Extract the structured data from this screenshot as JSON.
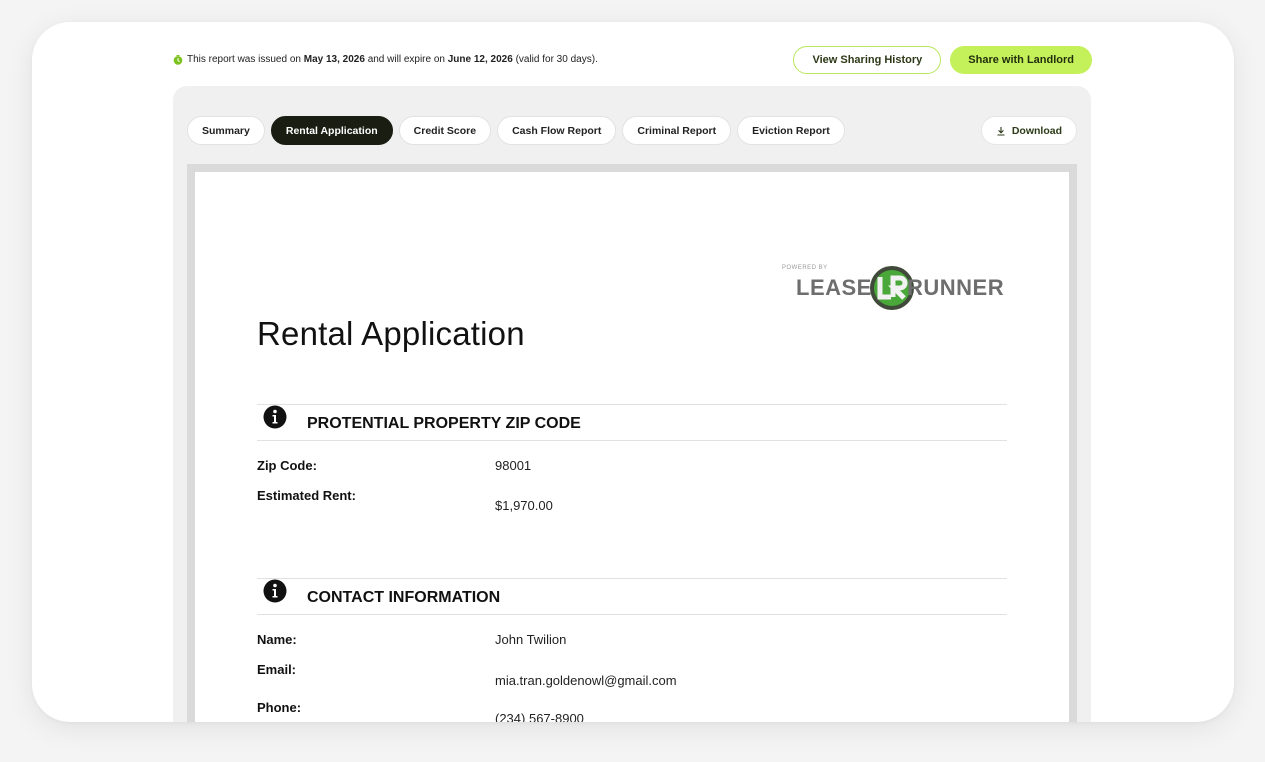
{
  "notice": {
    "prefix": "This report was issued on",
    "issued": "May 13, 2026",
    "middle": "and will expire on",
    "expires": "June 12, 2026",
    "suffix": "(valid for 30 days)."
  },
  "actions": {
    "view_history": "View Sharing History",
    "share": "Share with Landlord"
  },
  "tabs": [
    {
      "label": "Summary",
      "active": false
    },
    {
      "label": "Rental Application",
      "active": true
    },
    {
      "label": "Credit Score",
      "active": false
    },
    {
      "label": "Cash Flow Report",
      "active": false
    },
    {
      "label": "Criminal Report",
      "active": false
    },
    {
      "label": "Eviction Report",
      "active": false
    }
  ],
  "download_label": "Download",
  "document": {
    "logo": {
      "powered_by": "POWERED BY",
      "lease": "LEASE",
      "runner": "RUNNER"
    },
    "title": "Rental Application",
    "sections": [
      {
        "title": "PROTENTIAL PROPERTY ZIP CODE",
        "rows": [
          {
            "label": "Zip Code:",
            "value": "98001"
          },
          {
            "label": "Estimated Rent:",
            "value": "$1,970.00"
          }
        ]
      },
      {
        "title": "CONTACT INFORMATION",
        "rows": [
          {
            "label": "Name:",
            "value": "John Twilion"
          },
          {
            "label": "Email:",
            "value": "mia.tran.goldenowl@gmail.com"
          },
          {
            "label": "Phone:",
            "value": "(234) 567-8900"
          }
        ]
      }
    ]
  },
  "colors": {
    "accent": "#c4f05a",
    "accent_border": "#b8e85c",
    "active_tab": "#1a1e12"
  }
}
